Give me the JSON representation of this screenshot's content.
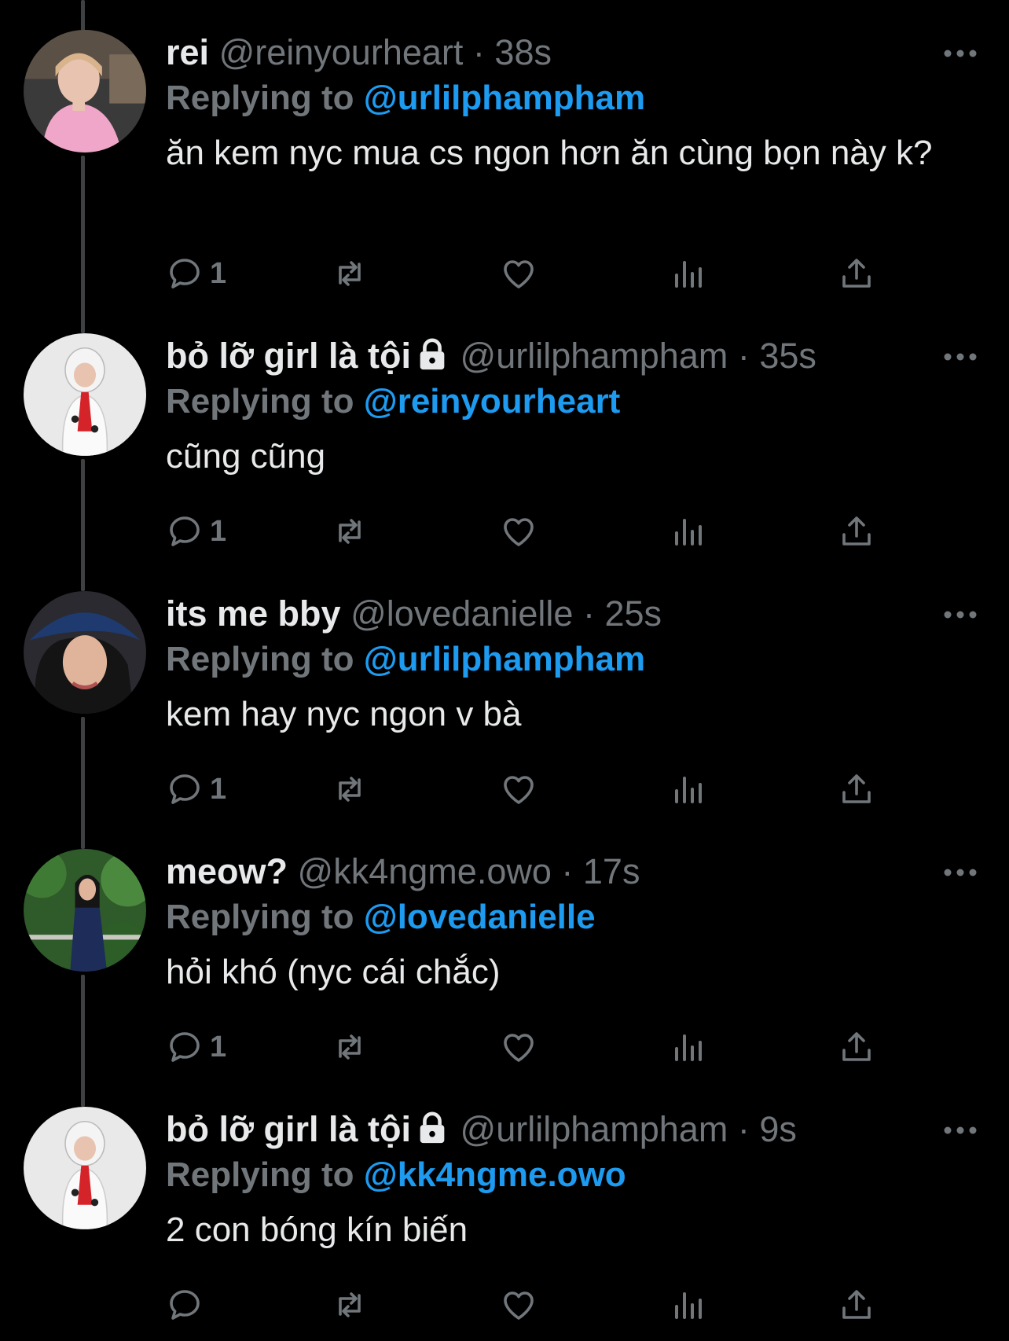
{
  "colors": {
    "background": "#000000",
    "primary_text": "#e7e9ea",
    "secondary_text": "#71767b",
    "link": "#1d9bf0",
    "thread_line": "#3e4144"
  },
  "tweets": [
    {
      "display_name": "rei",
      "locked": false,
      "handle": "@reinyourheart",
      "separator": "·",
      "time": "38s",
      "reply_label": "Replying to",
      "reply_to": "@urlilphampham",
      "text": "ăn kem nyc mua cs ngon hơn ăn cùng bọn này k?",
      "reply_count": "1",
      "avatar_icon": "avatar-photo-pink"
    },
    {
      "display_name": "bỏ lỡ girl là tội",
      "locked": true,
      "handle": "@urlilphampham",
      "separator": "·",
      "time": "35s",
      "reply_label": "Replying to",
      "reply_to": "@reinyourheart",
      "text": "cũng cũng",
      "reply_count": "1",
      "avatar_icon": "avatar-photo-costume"
    },
    {
      "display_name": "its me bby",
      "locked": false,
      "handle": "@lovedanielle",
      "separator": "·",
      "time": "25s",
      "reply_label": "Replying to",
      "reply_to": "@urlilphampham",
      "text": "kem hay nyc ngon v bà",
      "reply_count": "1",
      "avatar_icon": "avatar-photo-hat"
    },
    {
      "display_name": "meow?",
      "locked": false,
      "handle": "@kk4ngme.owo",
      "separator": "·",
      "time": "17s",
      "reply_label": "Replying to",
      "reply_to": "@lovedanielle",
      "text": "hỏi khó (nyc cái chắc)",
      "reply_count": "1",
      "avatar_icon": "avatar-photo-greenery"
    },
    {
      "display_name": "bỏ lỡ girl là tội",
      "locked": true,
      "handle": "@urlilphampham",
      "separator": "·",
      "time": "9s",
      "reply_label": "Replying to",
      "reply_to": "@kk4ngme.owo",
      "text": "2 con bóng kín biến",
      "reply_count": "",
      "avatar_icon": "avatar-photo-costume"
    }
  ]
}
